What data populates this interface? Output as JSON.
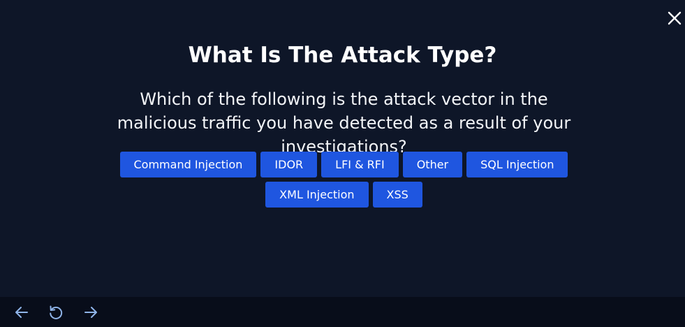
{
  "header": {
    "close_icon": "close-icon"
  },
  "question": {
    "title": "What Is The Attack Type?",
    "text": "Which of the following is the attack vector in the malicious traffic you have detected as a result of your investigations?"
  },
  "options": [
    "Command Injection",
    "IDOR",
    "LFI & RFI",
    "Other",
    "SQL Injection",
    "XML Injection",
    "XSS"
  ],
  "footer": {
    "icons": [
      "arrow-left-icon",
      "reset-icon",
      "arrow-right-icon"
    ]
  },
  "colors": {
    "background": "#0e1628",
    "footer_background": "#080d1a",
    "button": "#1f56e0",
    "nav_icon": "#8fb4e8"
  }
}
